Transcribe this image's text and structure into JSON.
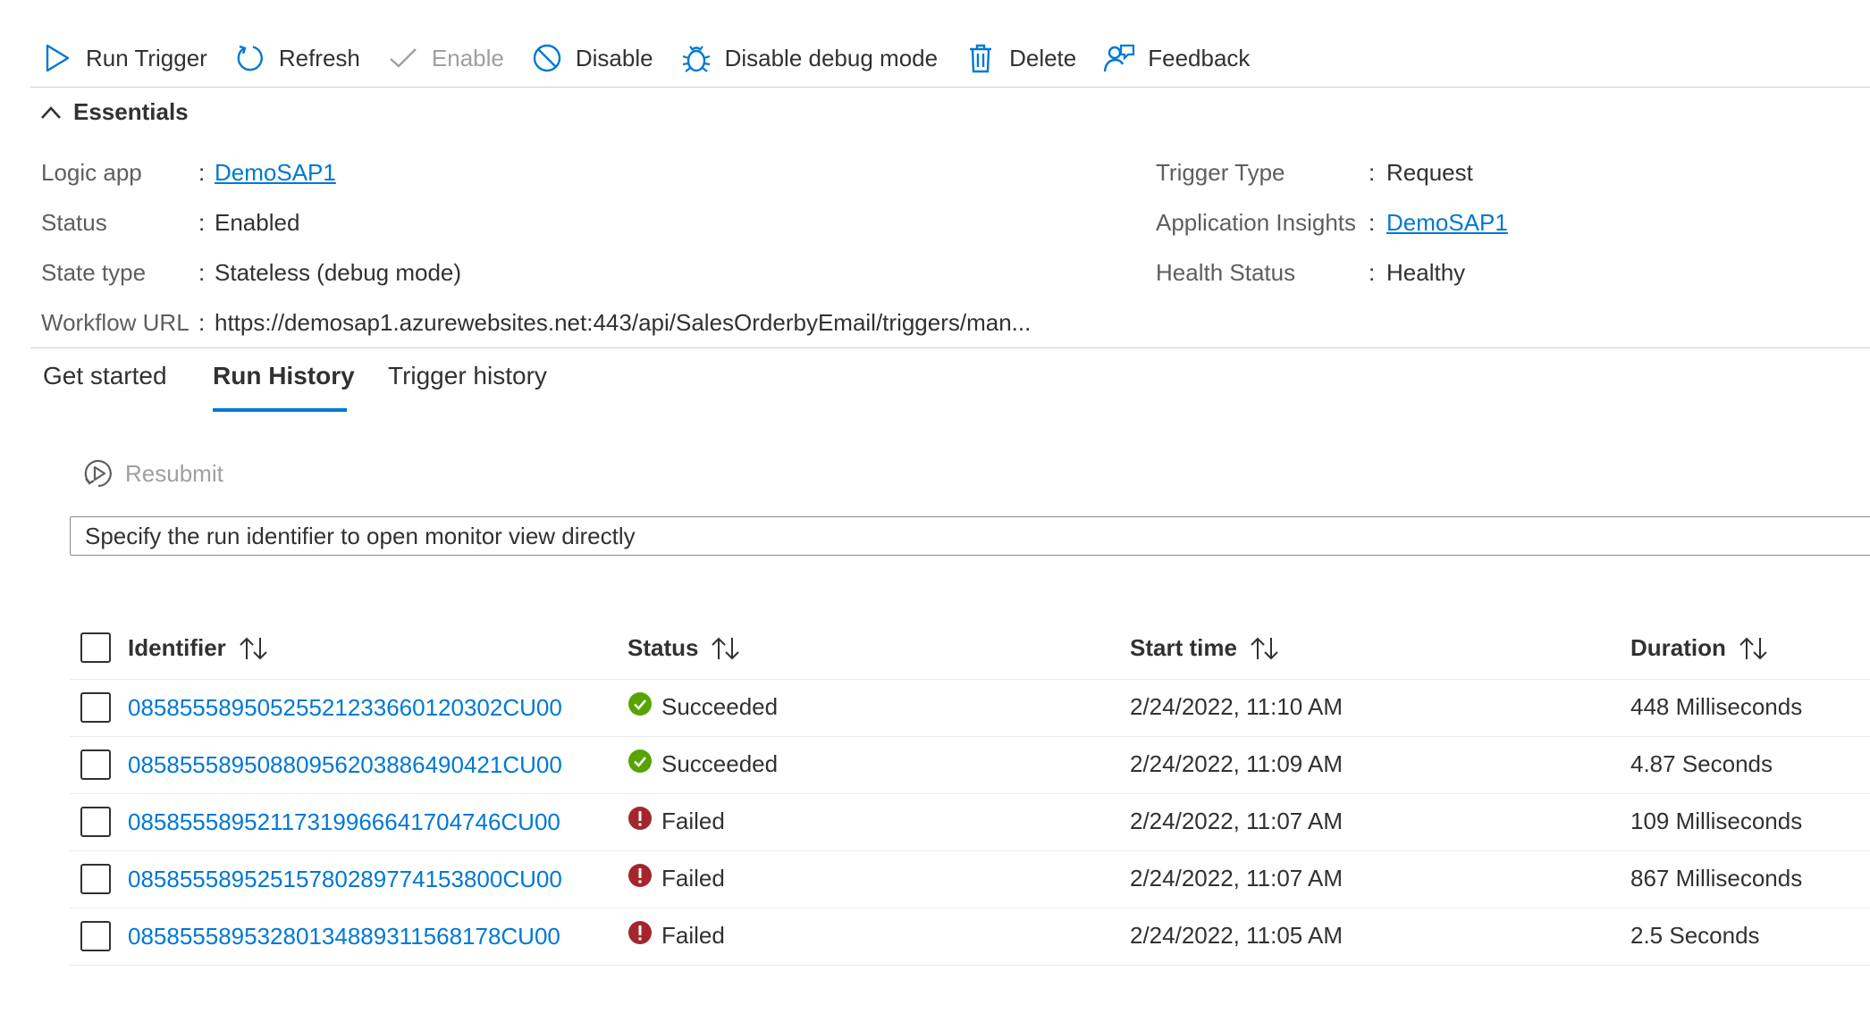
{
  "toolbar": {
    "run_trigger": "Run Trigger",
    "refresh": "Refresh",
    "enable": "Enable",
    "disable": "Disable",
    "disable_debug": "Disable debug mode",
    "delete": "Delete",
    "feedback": "Feedback"
  },
  "essentials": {
    "title": "Essentials",
    "left": [
      {
        "key": "Logic app",
        "value": "DemoSAP1"
      },
      {
        "key": "Status",
        "value": "Enabled"
      },
      {
        "key": "State type",
        "value": "Stateless (debug mode)"
      },
      {
        "key": "Workflow URL",
        "value": "https://demosap1.azurewebsites.net:443/api/SalesOrderbyEmail/triggers/man..."
      }
    ],
    "right": [
      {
        "key": "Trigger Type",
        "value": "Request"
      },
      {
        "key": "Application Insights",
        "value": "DemoSAP1"
      },
      {
        "key": "Health Status",
        "value": "Healthy"
      }
    ],
    "colon": ":"
  },
  "tabs": [
    {
      "label": "Get started"
    },
    {
      "label": "Run History",
      "active": true
    },
    {
      "label": "Trigger history"
    }
  ],
  "resubmit": {
    "label": "Resubmit"
  },
  "run_search": {
    "placeholder": "Specify the run identifier to open monitor view directly"
  },
  "table": {
    "headers": {
      "identifier": "Identifier",
      "status": "Status",
      "start_time": "Start time",
      "duration": "Duration"
    },
    "rows": [
      {
        "identifier": "08585558950525521233660120302CU00",
        "status": "Succeeded",
        "start_time": "2/24/2022, 11:10 AM",
        "duration": "448 Milliseconds"
      },
      {
        "identifier": "08585558950880956203886490421CU00",
        "status": "Succeeded",
        "start_time": "2/24/2022, 11:09 AM",
        "duration": "4.87 Seconds"
      },
      {
        "identifier": "08585558952117319966641704746CU00",
        "status": "Failed",
        "start_time": "2/24/2022, 11:07 AM",
        "duration": "109 Milliseconds"
      },
      {
        "identifier": "08585558952515780289774153800CU00",
        "status": "Failed",
        "start_time": "2/24/2022, 11:07 AM",
        "duration": "867 Milliseconds"
      },
      {
        "identifier": "08585558953280134889311568178CU00",
        "status": "Failed",
        "start_time": "2/24/2022, 11:05 AM",
        "duration": "2.5 Seconds"
      }
    ]
  },
  "colors": {
    "accent": "#0078d4",
    "success": "#57a300",
    "failed": "#a4262c"
  }
}
